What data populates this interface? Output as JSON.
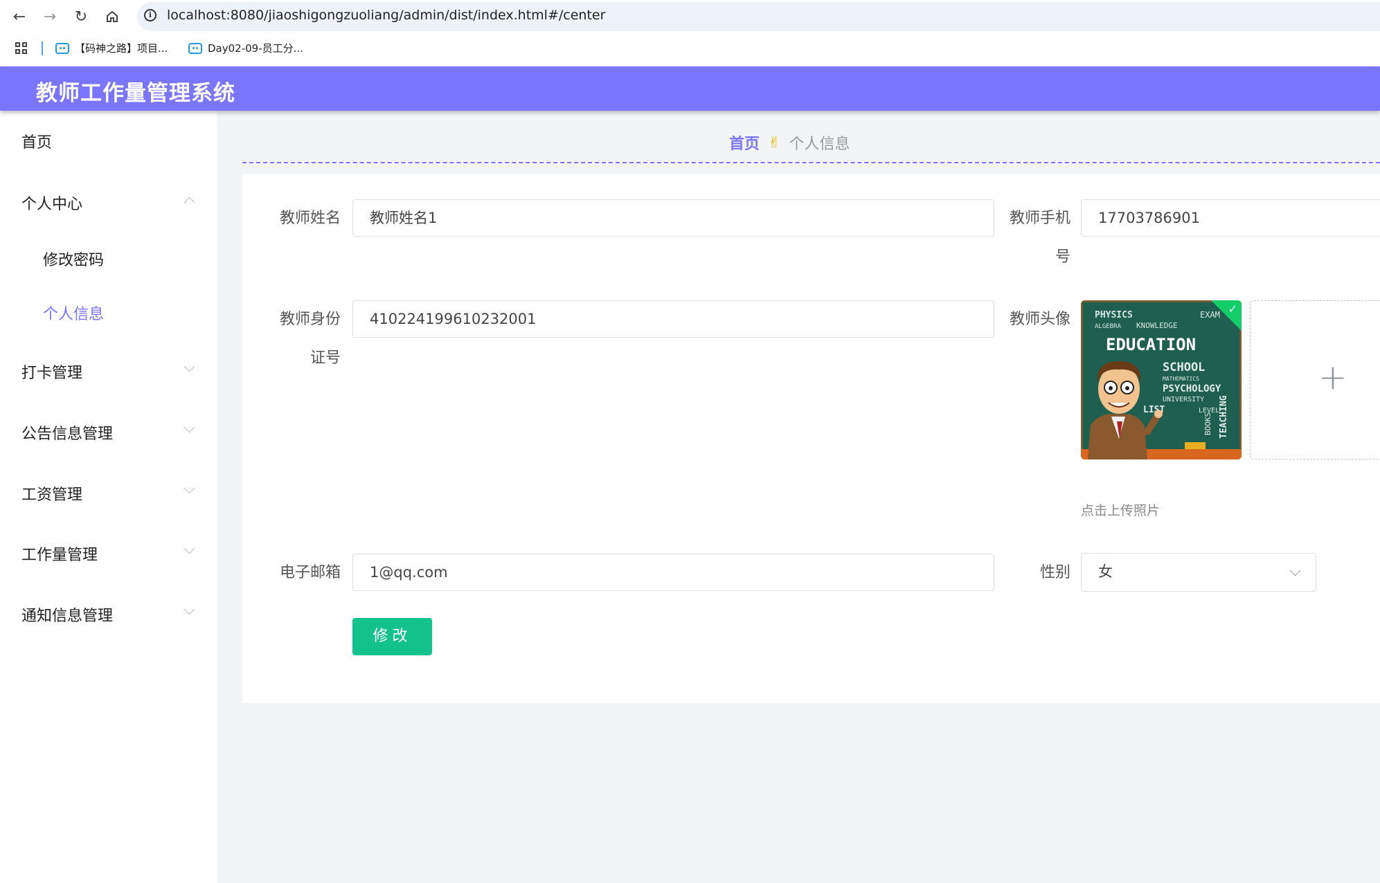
{
  "browser": {
    "url": "localhost:8080/jiaoshigongzuoliang/admin/dist/index.html#/center",
    "bookmarks": [
      "【码神之路】项目...",
      "Day02-09-员工分..."
    ]
  },
  "header": {
    "title": "教师工作量管理系统"
  },
  "sidebar": {
    "home": "首页",
    "personal_center": "个人中心",
    "change_password": "修改密码",
    "personal_info": "个人信息",
    "attendance": "打卡管理",
    "announcements": "公告信息管理",
    "salary": "工资管理",
    "workload": "工作量管理",
    "notifications": "通知信息管理"
  },
  "breadcrumb": {
    "home": "首页",
    "separator": "✌",
    "current": "个人信息"
  },
  "form": {
    "name_label": "教师姓名",
    "name_value": "教师姓名1",
    "phone_label_line1": "教师手机",
    "phone_label_line2": "号",
    "phone_value": "17703786901",
    "idcard_label_line1": "教师身份",
    "idcard_label_line2": "证号",
    "idcard_value": "410224199610232001",
    "avatar_label": "教师头像",
    "upload_tip": "点击上传照片",
    "email_label": "电子邮箱",
    "email_value": "1@qq.com",
    "gender_label": "性别",
    "gender_value": "女",
    "submit_label": "修改"
  },
  "avatar_image": {
    "words": [
      "PHYSICS",
      "EXAM",
      "ALGEBRA",
      "KNOWLEDGE",
      "EDUCATION",
      "SCHOOL",
      "MATHEMATICS",
      "PSYCHOLOGY",
      "UNIVERSITY",
      "LIST",
      "LEVEL",
      "TEACHING",
      "BOOKS"
    ]
  },
  "colors": {
    "accent": "#7a75fd",
    "button": "#13c28a",
    "success": "#13ce66",
    "background": "#f3f4f6"
  }
}
